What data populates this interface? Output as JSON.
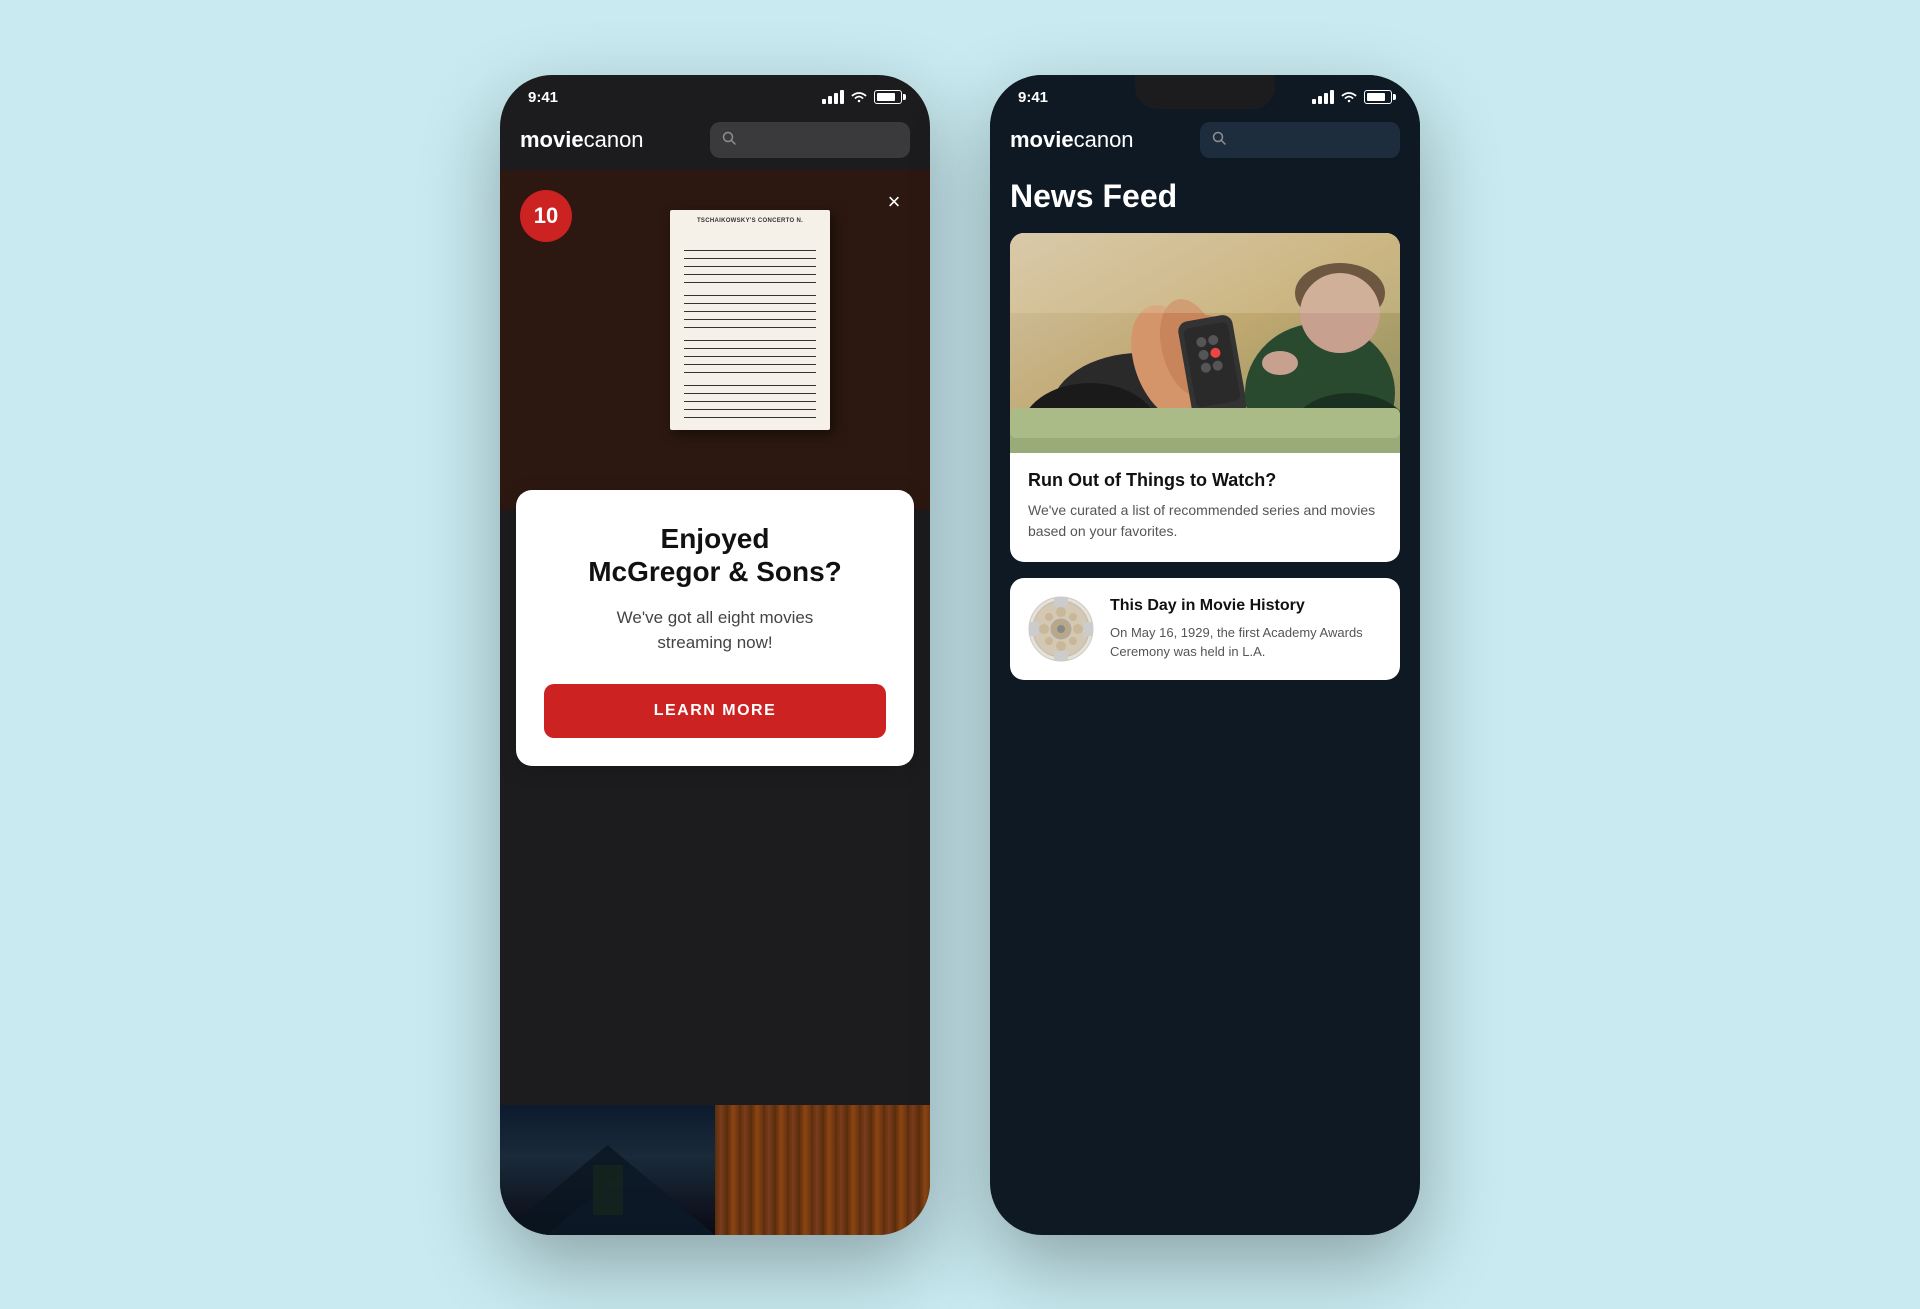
{
  "background_color": "#c8eaf0",
  "phone1": {
    "status_time": "9:41",
    "logo_bold": "movie",
    "logo_light": "canon",
    "search_placeholder": "",
    "badge_count": "10",
    "close_button_label": "×",
    "modal": {
      "title": "Enjoyed\nMcGregor & Sons?",
      "subtitle": "We've got all eight movies\nstreaming now!",
      "cta_label": "LEARN MORE"
    },
    "thumbnails": [
      "dark-mountain",
      "wood-curtains"
    ]
  },
  "phone2": {
    "status_time": "9:41",
    "logo_bold": "movie",
    "logo_light": "canon",
    "search_placeholder": "",
    "news_feed_title": "News Feed",
    "cards": [
      {
        "type": "large",
        "title": "Run Out of Things to Watch?",
        "body": "We've curated a list of recommended series and movies based on your favorites."
      },
      {
        "type": "small",
        "title": "This Day in Movie History",
        "body": "On May 16, 1929, the first Academy Awards Ceremony was held in L.A."
      }
    ]
  }
}
